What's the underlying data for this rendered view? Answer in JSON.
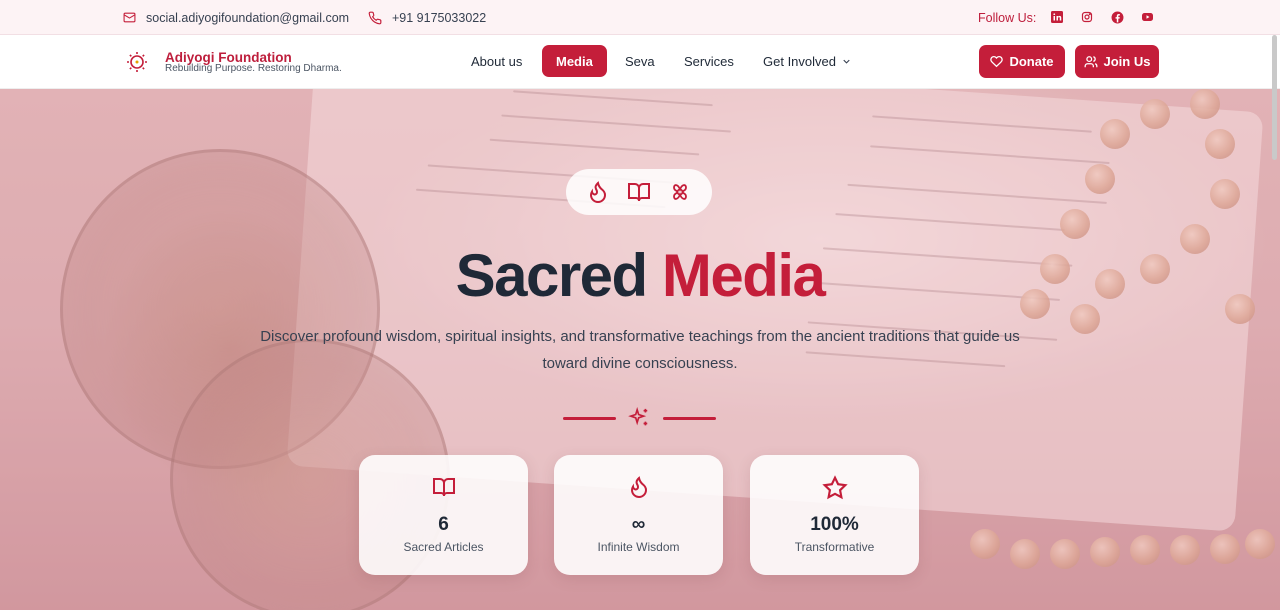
{
  "topbar": {
    "email": "social.adiyogifoundation@gmail.com",
    "phone": "+91 9175033022",
    "follow_label": "Follow Us:",
    "socials": [
      "linkedin-icon",
      "instagram-icon",
      "facebook-icon",
      "youtube-icon"
    ]
  },
  "brand": {
    "name": "Adiyogi Foundation",
    "tagline": "Rebuilding Purpose. Restoring Dharma."
  },
  "nav": {
    "items": [
      "About us",
      "Media",
      "Seva",
      "Services",
      "Get Involved"
    ],
    "active": "Media"
  },
  "actions": {
    "donate": "Donate",
    "join": "Join Us"
  },
  "hero": {
    "title_part1": "Sacred",
    "title_part2": "Media",
    "subtitle": "Discover profound wisdom, spiritual insights, and transformative teachings from the ancient traditions that guide us toward divine consciousness.",
    "pill_icons": [
      "flame-icon",
      "book-open-icon",
      "flower-icon"
    ]
  },
  "stats": [
    {
      "icon": "book-open-icon",
      "value": "6",
      "label": "Sacred Articles"
    },
    {
      "icon": "flame-icon",
      "value": "∞",
      "label": "Infinite Wisdom"
    },
    {
      "icon": "star-icon",
      "value": "100%",
      "label": "Transformative"
    }
  ],
  "colors": {
    "accent": "#c41e3a",
    "dark_text": "#1f2937",
    "topbar_bg": "#fdf3f5"
  }
}
